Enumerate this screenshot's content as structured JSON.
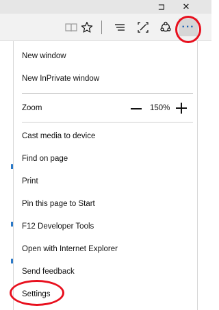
{
  "titlebar": {
    "restore_glyph": "⊐",
    "close_glyph": "✕"
  },
  "toolbar": {
    "icons": [
      "reading-view-icon",
      "favorite-star-icon",
      "hub-icon",
      "web-note-icon",
      "share-icon",
      "more-actions-icon"
    ],
    "more_glyph": "···"
  },
  "menu": {
    "new_window": "New window",
    "new_inprivate_window": "New InPrivate window",
    "zoom_label": "Zoom",
    "zoom_value": "150%",
    "cast_media": "Cast media to device",
    "find_on_page": "Find on page",
    "print": "Print",
    "pin_to_start": "Pin this page to Start",
    "f12_tools": "F12 Developer Tools",
    "open_with_ie": "Open with Internet Explorer",
    "send_feedback": "Send feedback",
    "settings": "Settings"
  },
  "colors": {
    "highlight": "#e8101e",
    "accent": "#2b79c7"
  }
}
